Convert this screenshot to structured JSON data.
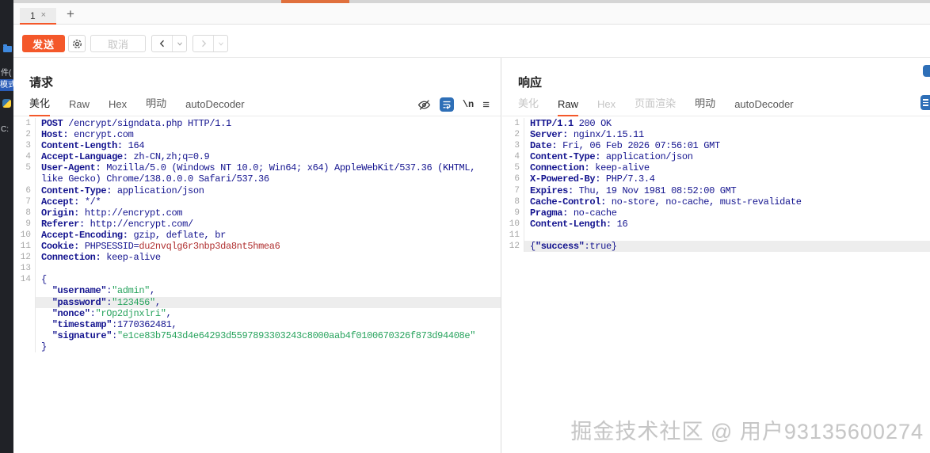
{
  "colors": {
    "accent": "#f4582a",
    "editor_text": "#14148f",
    "string_green": "#27a35d",
    "cookie_red": "#b03030",
    "icon_blue": "#2e6fb7"
  },
  "background_app": {
    "file_menu_fragment": "件(",
    "selected_item_fragment": "模式",
    "path_fragment": "C:"
  },
  "tab_bar": {
    "tab_label": "1",
    "tab_close": "×",
    "add_tab": "+"
  },
  "toolbar": {
    "send": "发送",
    "cancel": "取消"
  },
  "request": {
    "title": "请求",
    "tabs": [
      {
        "label": "美化",
        "state": "active"
      },
      {
        "label": "Raw",
        "state": "normal"
      },
      {
        "label": "Hex",
        "state": "normal"
      },
      {
        "label": "明动",
        "state": "normal"
      },
      {
        "label": "autoDecoder",
        "state": "normal"
      }
    ],
    "newline_icon_label": "\\n",
    "lines": [
      {
        "n": "1",
        "segs": [
          [
            "k",
            "POST"
          ],
          [
            "t",
            " /encrypt/signdata.php HTTP/1.1"
          ]
        ]
      },
      {
        "n": "2",
        "segs": [
          [
            "k",
            "Host:"
          ],
          [
            "t",
            " encrypt.com"
          ]
        ]
      },
      {
        "n": "3",
        "segs": [
          [
            "k",
            "Content-Length:"
          ],
          [
            "t",
            " 164"
          ]
        ]
      },
      {
        "n": "4",
        "segs": [
          [
            "k",
            "Accept-Language:"
          ],
          [
            "t",
            " zh-CN,zh;q=0.9"
          ]
        ]
      },
      {
        "n": "5",
        "segs": [
          [
            "k",
            "User-Agent:"
          ],
          [
            "t",
            " Mozilla/5.0 (Windows NT 10.0; Win64; x64) AppleWebKit/537.36 (KHTML,"
          ]
        ]
      },
      {
        "n": "",
        "segs": [
          [
            "t",
            "like Gecko) Chrome/138.0.0.0 Safari/537.36"
          ]
        ]
      },
      {
        "n": "6",
        "segs": [
          [
            "k",
            "Content-Type:"
          ],
          [
            "t",
            " application/json"
          ]
        ]
      },
      {
        "n": "7",
        "segs": [
          [
            "k",
            "Accept:"
          ],
          [
            "t",
            " */*"
          ]
        ]
      },
      {
        "n": "8",
        "segs": [
          [
            "k",
            "Origin:"
          ],
          [
            "t",
            " http://encrypt.com"
          ]
        ]
      },
      {
        "n": "9",
        "segs": [
          [
            "k",
            "Referer:"
          ],
          [
            "t",
            " http://encrypt.com/"
          ]
        ]
      },
      {
        "n": "10",
        "segs": [
          [
            "k",
            "Accept-Encoding:"
          ],
          [
            "t",
            " gzip, deflate, br"
          ]
        ]
      },
      {
        "n": "11",
        "segs": [
          [
            "k",
            "Cookie:"
          ],
          [
            "t",
            " PHPSESSID="
          ],
          [
            "r",
            "du2nvqlg6r3nbp3da8nt5hmea6"
          ]
        ]
      },
      {
        "n": "12",
        "ul": true,
        "segs": [
          [
            "k",
            "Connection:"
          ],
          [
            "t",
            " keep-alive"
          ]
        ]
      },
      {
        "n": "13",
        "segs": []
      },
      {
        "n": "14",
        "segs": [
          [
            "t",
            "{"
          ]
        ]
      },
      {
        "n": "",
        "segs": [
          [
            "t",
            "  "
          ],
          [
            "k",
            "\"username\""
          ],
          [
            "t",
            ":"
          ],
          [
            "g",
            "\"admin\""
          ],
          [
            "t",
            ","
          ]
        ]
      },
      {
        "n": "",
        "hl": true,
        "segs": [
          [
            "t",
            "  "
          ],
          [
            "k",
            "\"password\""
          ],
          [
            "t",
            ":"
          ],
          [
            "g",
            "\"123456\""
          ],
          [
            "t",
            ","
          ]
        ]
      },
      {
        "n": "",
        "segs": [
          [
            "t",
            "  "
          ],
          [
            "k",
            "\"nonce\""
          ],
          [
            "t",
            ":"
          ],
          [
            "g",
            "\"rOp2djnxlri\""
          ],
          [
            "t",
            ","
          ]
        ]
      },
      {
        "n": "",
        "segs": [
          [
            "t",
            "  "
          ],
          [
            "k",
            "\"timestamp\""
          ],
          [
            "t",
            ":"
          ],
          [
            "t",
            "1770362481,"
          ]
        ]
      },
      {
        "n": "",
        "segs": [
          [
            "t",
            "  "
          ],
          [
            "k",
            "\"signature\""
          ],
          [
            "t",
            ":"
          ],
          [
            "g",
            "\"e1ce83b7543d4e64293d5597893303243c8000aab4f0100670326f873d94408e\""
          ]
        ]
      },
      {
        "n": "",
        "segs": [
          [
            "t",
            "}"
          ]
        ]
      }
    ]
  },
  "response": {
    "title": "响应",
    "tabs": [
      {
        "label": "美化",
        "state": "disabled"
      },
      {
        "label": "Raw",
        "state": "active"
      },
      {
        "label": "Hex",
        "state": "disabled"
      },
      {
        "label": "页面渲染",
        "state": "disabled"
      },
      {
        "label": "明动",
        "state": "normal"
      },
      {
        "label": "autoDecoder",
        "state": "normal"
      }
    ],
    "lines": [
      {
        "n": "1",
        "segs": [
          [
            "k",
            "HTTP/1.1"
          ],
          [
            "t",
            " 200 OK"
          ]
        ]
      },
      {
        "n": "2",
        "segs": [
          [
            "k",
            "Server:"
          ],
          [
            "t",
            " nginx/1.15.11"
          ]
        ]
      },
      {
        "n": "3",
        "segs": [
          [
            "k",
            "Date:"
          ],
          [
            "t",
            " Fri, 06 Feb 2026 07:56:01 GMT"
          ]
        ]
      },
      {
        "n": "4",
        "segs": [
          [
            "k",
            "Content-Type:"
          ],
          [
            "t",
            " application/json"
          ]
        ]
      },
      {
        "n": "5",
        "segs": [
          [
            "k",
            "Connection:"
          ],
          [
            "t",
            " keep-alive"
          ]
        ]
      },
      {
        "n": "6",
        "segs": [
          [
            "k",
            "X-Powered-By:"
          ],
          [
            "t",
            " PHP/7.3.4"
          ]
        ]
      },
      {
        "n": "7",
        "segs": [
          [
            "k",
            "Expires:"
          ],
          [
            "t",
            " Thu, 19 Nov 1981 08:52:00 GMT"
          ]
        ]
      },
      {
        "n": "8",
        "segs": [
          [
            "k",
            "Cache-Control:"
          ],
          [
            "t",
            " no-store, no-cache, must-revalidate"
          ]
        ]
      },
      {
        "n": "9",
        "segs": [
          [
            "k",
            "Pragma:"
          ],
          [
            "t",
            " no-cache"
          ]
        ]
      },
      {
        "n": "10",
        "segs": [
          [
            "k",
            "Content-Length:"
          ],
          [
            "t",
            " 16"
          ]
        ]
      },
      {
        "n": "11",
        "segs": []
      },
      {
        "n": "12",
        "hl": true,
        "segs": [
          [
            "t",
            "{"
          ],
          [
            "k",
            "\"success\""
          ],
          [
            "t",
            ":"
          ],
          [
            "t",
            "true}"
          ]
        ]
      }
    ]
  },
  "watermark": "掘金技术社区 @ 用户93135600274"
}
